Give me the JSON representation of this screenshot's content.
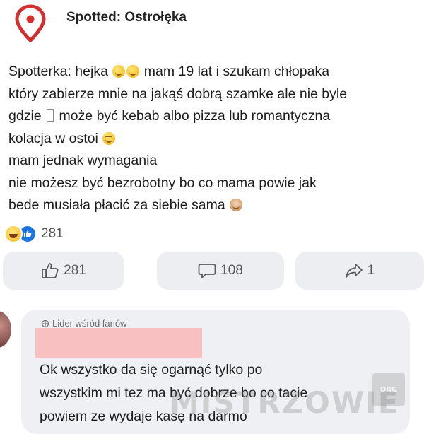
{
  "header": {
    "page_name": "Spotted: Ostrołęka",
    "icon": "map-pin-icon",
    "icon_color": "#d32f2f"
  },
  "post": {
    "line1_a": "Spotterka: hejka",
    "line1_b": "mam 19 lat i szukam chłopaka",
    "line2": "który zabierze mnie na jakąś dobrą szamke ale nie byle",
    "line3_a": "gdzie",
    "line3_b": "może być kebab albo pizza lub romantyczna",
    "line4": "kolacja w ostoi",
    "line5": "mam jednak wymagania",
    "line6": "nie możesz być bezrobotny bo co mama powie jak",
    "line7": "bede musiała płacić za siebie sama"
  },
  "reactions": {
    "count": "281",
    "types": [
      "haha-icon",
      "like-icon"
    ]
  },
  "actions": {
    "like_count": "281",
    "comment_count": "108",
    "share_count": "1"
  },
  "comment": {
    "badge": "Lider wśród fanów",
    "lines": [
      "Ok wszystko da się ogarnąć tylko po",
      "wszystkim mi tez ma być dobrze bo co tacie",
      "powiem ze wydaje kasę na darmo"
    ]
  },
  "watermark": {
    "text": "MISTRZOWIE",
    "badge_text": "ORG"
  },
  "colors": {
    "accent": "#1b74e4",
    "button_bg": "#eceef2",
    "comment_bg": "#eef0f3",
    "redaction": "#f8c0c0"
  }
}
